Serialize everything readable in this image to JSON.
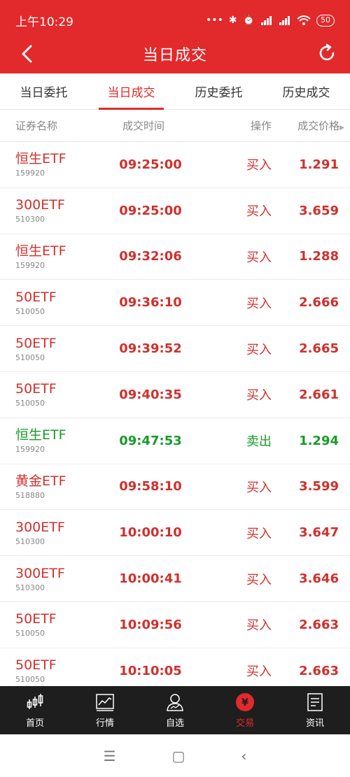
{
  "status_bar": {
    "time": "上午10:29",
    "battery": "50"
  },
  "header": {
    "title": "当日成交"
  },
  "tabs": [
    {
      "label": "当日委托"
    },
    {
      "label": "当日成交"
    },
    {
      "label": "历史委托"
    },
    {
      "label": "历史成交"
    }
  ],
  "table": {
    "headers": {
      "name": "证券名称",
      "time": "成交时间",
      "action": "操作",
      "price": "成交价格"
    },
    "rows": [
      {
        "name": "恒生ETF",
        "code": "159920",
        "time": "09:25:00",
        "action": "买入",
        "price": "1.291"
      },
      {
        "name": "300ETF",
        "code": "510300",
        "time": "09:25:00",
        "action": "买入",
        "price": "3.659"
      },
      {
        "name": "恒生ETF",
        "code": "159920",
        "time": "09:32:06",
        "action": "买入",
        "price": "1.288"
      },
      {
        "name": "50ETF",
        "code": "510050",
        "time": "09:36:10",
        "action": "买入",
        "price": "2.666"
      },
      {
        "name": "50ETF",
        "code": "510050",
        "time": "09:39:52",
        "action": "买入",
        "price": "2.665"
      },
      {
        "name": "50ETF",
        "code": "510050",
        "time": "09:40:35",
        "action": "买入",
        "price": "2.661"
      },
      {
        "name": "恒生ETF",
        "code": "159920",
        "time": "09:47:53",
        "action": "卖出",
        "price": "1.294"
      },
      {
        "name": "黄金ETF",
        "code": "518880",
        "time": "09:58:10",
        "action": "买入",
        "price": "3.599"
      },
      {
        "name": "300ETF",
        "code": "510300",
        "time": "10:00:10",
        "action": "买入",
        "price": "3.647"
      },
      {
        "name": "300ETF",
        "code": "510300",
        "time": "10:00:41",
        "action": "买入",
        "price": "3.646"
      },
      {
        "name": "50ETF",
        "code": "510050",
        "time": "10:09:56",
        "action": "买入",
        "price": "2.663"
      },
      {
        "name": "50ETF",
        "code": "510050",
        "time": "10:10:05",
        "action": "买入",
        "price": "2.663"
      }
    ]
  },
  "bottom_nav": [
    {
      "label": "首页",
      "icon": "candlestick-icon"
    },
    {
      "label": "行情",
      "icon": "chart-icon"
    },
    {
      "label": "自选",
      "icon": "user-icon"
    },
    {
      "label": "交易",
      "icon": "yen-icon"
    },
    {
      "label": "资讯",
      "icon": "news-icon"
    }
  ],
  "colors": {
    "brand": "#e2292b",
    "buy": "#d0302c",
    "sell": "#1a9a2a"
  }
}
